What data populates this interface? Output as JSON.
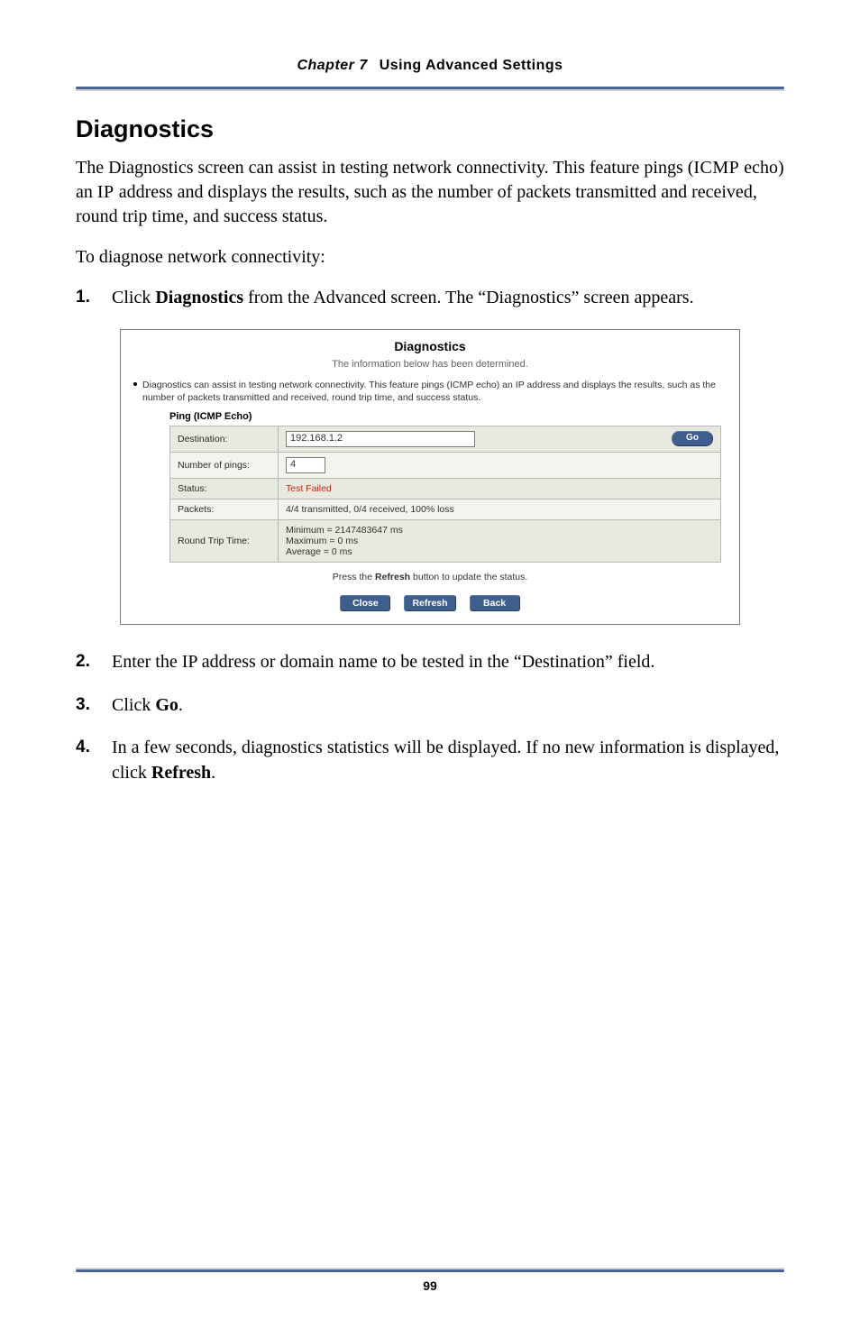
{
  "header": {
    "chapter_label": "Chapter 7",
    "chapter_title": "Using Advanced Settings"
  },
  "section_title": "Diagnostics",
  "para1": {
    "pre": "The Diagnostics screen can assist in testing network connectivity. This feature pings (",
    "sc1": "ICMP",
    "mid1": " echo) an ",
    "sc2": "IP",
    "post": " address and displays the results, such as the number of packets transmitted and received, round trip time, and success status."
  },
  "para2": "To diagnose network connectivity:",
  "steps": {
    "s1": {
      "num": "1.",
      "pre": "Click ",
      "bold": "Diagnostics",
      "post": " from the Advanced screen. The “Diagnostics” screen appears."
    },
    "s2": {
      "num": "2.",
      "pre": "Enter the ",
      "sc": "IP",
      "post": " address or domain name to be tested in the “Destination” field."
    },
    "s3": {
      "num": "3.",
      "pre": "Click ",
      "bold": "Go",
      "post": "."
    },
    "s4": {
      "num": "4.",
      "pre": "In a few seconds, diagnostics statistics will be displayed. If no new information is displayed, click ",
      "bold": "Refresh",
      "post": "."
    }
  },
  "dialog": {
    "title": "Diagnostics",
    "subtitle": "The information below has been determined.",
    "note": "Diagnostics can assist in testing network connectivity. This feature pings (ICMP echo) an IP address and displays the results, such as the number of packets transmitted and received, round trip time, and success status.",
    "section_label": "Ping (ICMP Echo)",
    "rows": {
      "dest_label": "Destination:",
      "dest_value": "192.168.1.2",
      "go_label": "Go",
      "pings_label": "Number of pings:",
      "pings_value": "4",
      "status_label": "Status:",
      "status_value": "Test Failed",
      "packets_label": "Packets:",
      "packets_value": "4/4 transmitted, 0/4 received, 100% loss",
      "rtt_label": "Round Trip Time:",
      "rtt_line1": "Minimum = 2147483647 ms",
      "rtt_line2": "Maximum = 0 ms",
      "rtt_line3": "Average = 0 ms"
    },
    "help_pre": "Press the ",
    "help_bold": "Refresh",
    "help_post": " button to update the status.",
    "buttons": {
      "close": "Close",
      "refresh": "Refresh",
      "back": "Back"
    }
  },
  "page_number": "99"
}
